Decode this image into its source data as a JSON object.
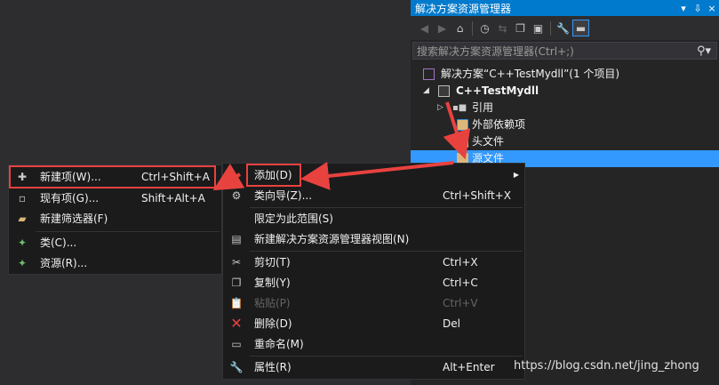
{
  "solution_explorer": {
    "title": "解决方案资源管理器",
    "title_buttons": [
      "▾",
      "⇩",
      "×"
    ],
    "search_placeholder": "搜索解决方案资源管理器(Ctrl+;)",
    "tree": [
      {
        "label": "解决方案“C++TestMydll”(1 个项目)",
        "icon": "solution-icon"
      },
      {
        "label": "C++TestMydll",
        "icon": "project-icon"
      },
      {
        "label": "引用",
        "icon": "references-icon"
      },
      {
        "label": "外部依赖项",
        "icon": "external-deps-icon"
      },
      {
        "label": "头文件",
        "icon": "folder-icon"
      },
      {
        "label": "源文件",
        "icon": "folder-icon"
      }
    ]
  },
  "context_menu": {
    "items": [
      {
        "label": "添加(D)",
        "shortcut": ""
      },
      {
        "label": "类向导(Z)...",
        "shortcut": "Ctrl+Shift+X"
      },
      {
        "label": "限定为此范围(S)",
        "shortcut": ""
      },
      {
        "label": "新建解决方案资源管理器视图(N)",
        "shortcut": ""
      },
      {
        "label": "剪切(T)",
        "shortcut": "Ctrl+X"
      },
      {
        "label": "复制(Y)",
        "shortcut": "Ctrl+C"
      },
      {
        "label": "粘贴(P)",
        "shortcut": "Ctrl+V"
      },
      {
        "label": "删除(D)",
        "shortcut": "Del"
      },
      {
        "label": "重命名(M)",
        "shortcut": ""
      },
      {
        "label": "属性(R)",
        "shortcut": "Alt+Enter"
      }
    ]
  },
  "add_submenu": {
    "items": [
      {
        "label": "新建项(W)...",
        "shortcut": "Ctrl+Shift+A"
      },
      {
        "label": "现有项(G)...",
        "shortcut": "Shift+Alt+A"
      },
      {
        "label": "新建筛选器(F)",
        "shortcut": ""
      },
      {
        "label": "类(C)...",
        "shortcut": ""
      },
      {
        "label": "资源(R)...",
        "shortcut": ""
      }
    ]
  },
  "watermark": "https://blog.csdn.net/jing_zhong",
  "colors": {
    "accent": "#007acc",
    "selection": "#3399ff",
    "highlight": "#e8423f",
    "menu_bg": "#1b1b1c"
  }
}
